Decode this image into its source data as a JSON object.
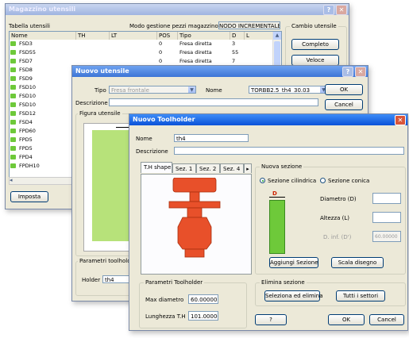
{
  "mag": {
    "title": "Magazzino utensili",
    "list_label": "Tabella utensili",
    "mode_label": "Modo gestione pezzi magazzino",
    "mode_value": "NODO INCREMENTALE",
    "cambio_label": "Cambio utensile",
    "btn_completo": "Completo",
    "btn_veloce": "Veloce",
    "btn_imposta": "Imposta",
    "headers": [
      "Nome",
      "TH",
      "LT",
      "POS",
      "Tipo",
      "D",
      "L"
    ],
    "rows": [
      {
        "name": "FSD3",
        "pos": "0",
        "tipo": "Fresa diretta",
        "d": "3"
      },
      {
        "name": "FSD55",
        "pos": "0",
        "tipo": "Fresa diretta",
        "d": "55"
      },
      {
        "name": "FSD7",
        "pos": "0",
        "tipo": "Fresa diretta",
        "d": "7"
      },
      {
        "name": "FSD8",
        "pos": "",
        "tipo": "",
        "d": ""
      },
      {
        "name": "FSD9",
        "pos": "",
        "tipo": "",
        "d": ""
      },
      {
        "name": "FSD10",
        "pos": "",
        "tipo": "",
        "d": ""
      },
      {
        "name": "FSD10",
        "pos": "",
        "tipo": "",
        "d": ""
      },
      {
        "name": "FSD10",
        "pos": "",
        "tipo": "",
        "d": ""
      },
      {
        "name": "FSD12",
        "pos": "",
        "tipo": "",
        "d": ""
      },
      {
        "name": "FSD4",
        "pos": "",
        "tipo": "",
        "d": ""
      },
      {
        "name": "FPD60",
        "pos": "",
        "tipo": "",
        "d": ""
      },
      {
        "name": "FPD5",
        "pos": "",
        "tipo": "",
        "d": ""
      },
      {
        "name": "FPD5",
        "pos": "",
        "tipo": "",
        "d": ""
      },
      {
        "name": "FPD4",
        "pos": "",
        "tipo": "",
        "d": ""
      },
      {
        "name": "FPDH10",
        "pos": "",
        "tipo": "",
        "d": ""
      }
    ]
  },
  "nu": {
    "title": "Nuovo utensile",
    "tipo_label": "Tipo",
    "tipo_value": "Fresa frontale",
    "nome_label": "Nome",
    "nome_value": "TORBB2.5_th4_30.03",
    "desc_label": "Descrizione",
    "figura_label": "Figura utensile",
    "btn_ok": "OK",
    "btn_cancel": "Cancel",
    "param_label": "Parametri toolholder",
    "holder_label": "Holder",
    "holder_value": "th4"
  },
  "nt": {
    "title": "Nuovo Toolholder",
    "nome_label": "Nome",
    "nome_value": "th4",
    "desc_label": "Descrizione",
    "desc_value": "",
    "tabs": [
      "T.H shape",
      "Sez. 1",
      "Sez. 2",
      "Sez. 4"
    ],
    "tab_arrow": "▸",
    "nuova_sezione": "Nuova sezione",
    "radio_cilindrica": "Sezione cilindrica",
    "radio_conica": "Sezione conica",
    "diametro_label": "Diametro (D)",
    "altezza_label": "Altezza (L)",
    "diam_top_label": "D. inf.  (D')",
    "diam_top_value": "60.00000",
    "sect_mark": "D",
    "btn_aggiungi": "Aggiungi Sezione",
    "btn_scala": "Scala disegno",
    "elimina_label": "Elimina sezione",
    "btn_sel_elimina": "Seleziona ed elimina",
    "btn_tutti": "Tutti i settori",
    "param_label": "Parametri Toolholder",
    "max_diam_label": "Max diametro",
    "max_diam_value": "60.00000",
    "lunghezza_label": "Lunghezza T.H",
    "lunghezza_value": "101.00000",
    "btn_help": "?",
    "btn_ok": "OK",
    "btn_cancel": "Cancel"
  },
  "colors": {
    "holder_shape": "#e8502a",
    "section_preview": "#6ec93a",
    "title_active": "#0a52d8"
  }
}
